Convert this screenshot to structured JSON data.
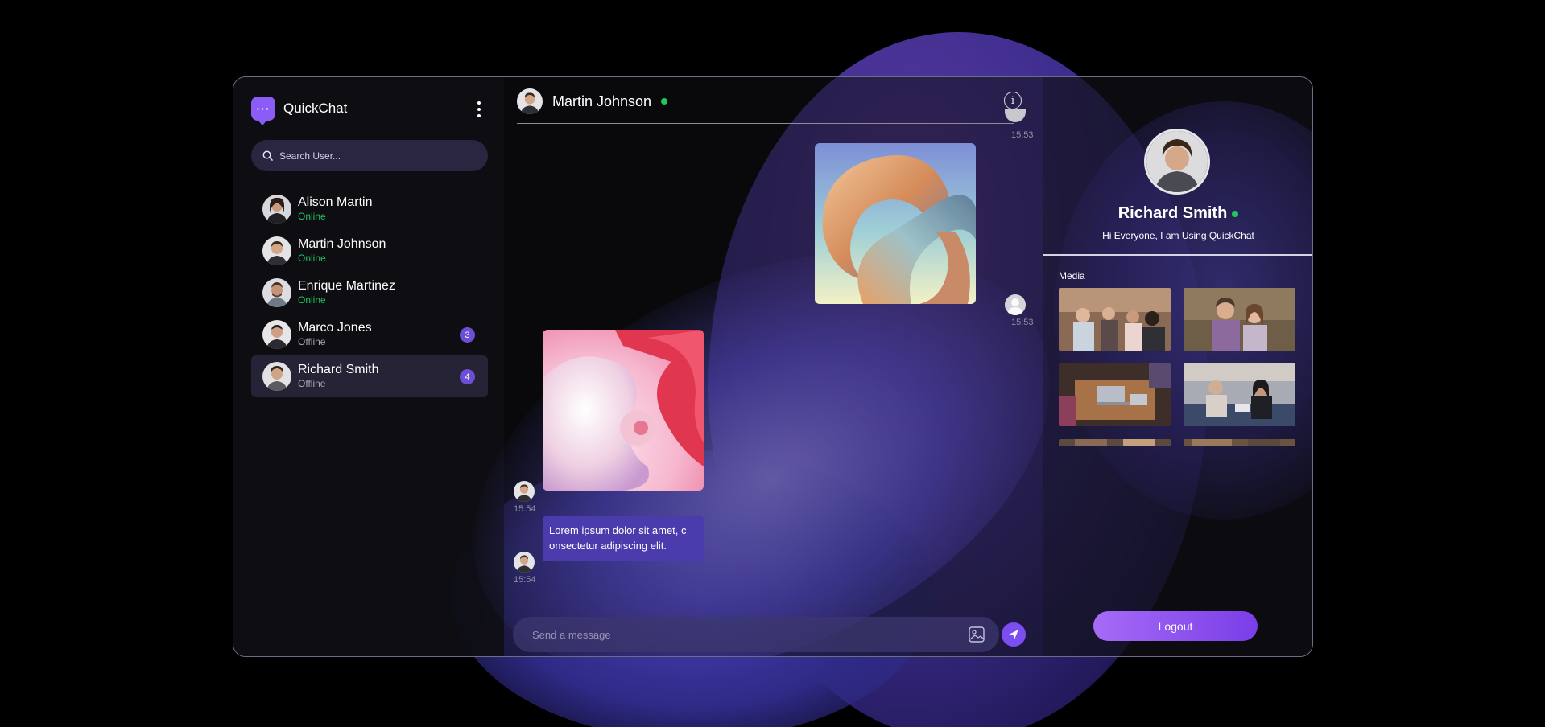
{
  "app": {
    "name": "QuickChat"
  },
  "search": {
    "placeholder": "Search User..."
  },
  "contacts": [
    {
      "name": "Alison Martin",
      "status": "Online",
      "unread": ""
    },
    {
      "name": "Martin Johnson",
      "status": "Online",
      "unread": ""
    },
    {
      "name": "Enrique Martinez",
      "status": "Online",
      "unread": ""
    },
    {
      "name": "Marco Jones",
      "status": "Offline",
      "unread": "3"
    },
    {
      "name": "Richard Smith",
      "status": "Offline",
      "unread": "4"
    }
  ],
  "chat": {
    "contact_name": "Martin Johnson",
    "messages": [
      {
        "time": "15:53"
      },
      {
        "time": "15:53"
      },
      {
        "time": "15:54"
      },
      {
        "time": "15:54",
        "text": "Lorem ipsum dolor sit amet, c onsectetur adipiscing elit."
      }
    ],
    "composer_placeholder": "Send a message"
  },
  "profile": {
    "name": "Richard Smith",
    "bio": "Hi Everyone, I am Using QuickChat",
    "media_label": "Media",
    "logout_label": "Logout"
  },
  "colors": {
    "accent": "#8b5cf6",
    "online": "#22c55e",
    "badge": "#6d4fd6"
  }
}
